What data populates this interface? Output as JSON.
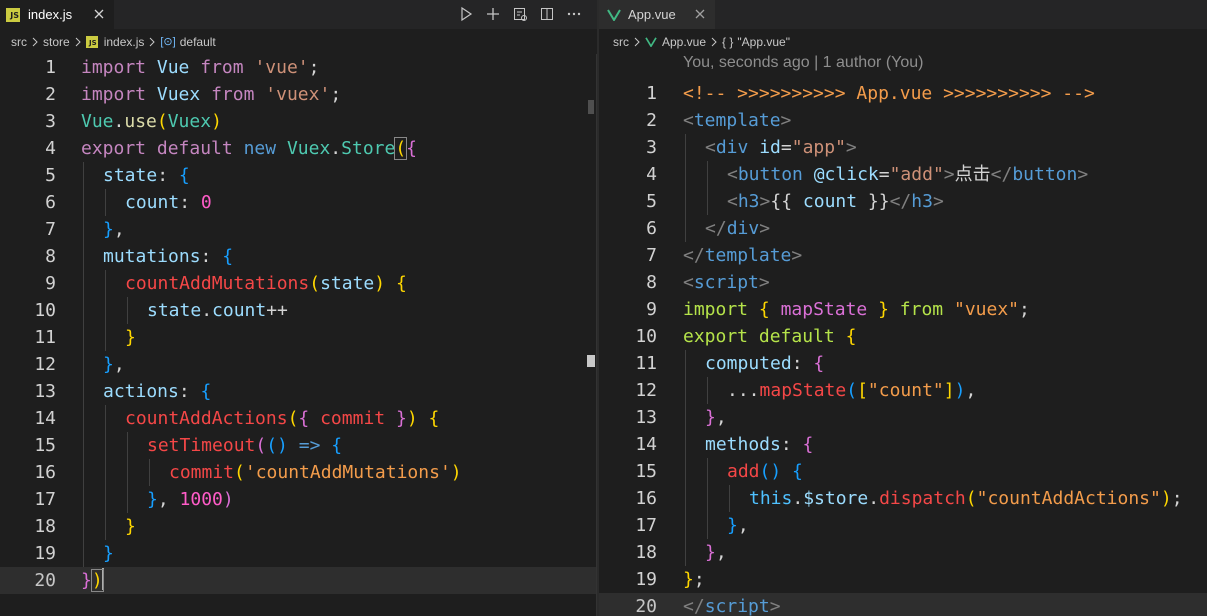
{
  "left_editor": {
    "tab": {
      "file_name": "index.js",
      "icon": "js-file-icon",
      "close": "close-icon"
    },
    "actions": [
      "run-icon",
      "split-add-icon",
      "open-changes-icon",
      "split-editor-icon",
      "more-actions-icon"
    ],
    "breadcrumb": {
      "folder1": "src",
      "folder2": "store",
      "file": "index.js",
      "symbol": "default"
    },
    "active_line": 20,
    "lines": [
      {
        "n": "1"
      },
      {
        "n": "2"
      },
      {
        "n": "3"
      },
      {
        "n": "4"
      },
      {
        "n": "5"
      },
      {
        "n": "6"
      },
      {
        "n": "7"
      },
      {
        "n": "8"
      },
      {
        "n": "9"
      },
      {
        "n": "10"
      },
      {
        "n": "11"
      },
      {
        "n": "12"
      },
      {
        "n": "13"
      },
      {
        "n": "14"
      },
      {
        "n": "15"
      },
      {
        "n": "16"
      },
      {
        "n": "17"
      },
      {
        "n": "18"
      },
      {
        "n": "19"
      },
      {
        "n": "20"
      }
    ],
    "tokens": {
      "l1": [
        "import",
        " ",
        "Vue",
        " ",
        "from",
        " ",
        "'vue'",
        ";"
      ],
      "l2": [
        "import",
        " ",
        "Vuex",
        " ",
        "from",
        " ",
        "'vuex'",
        ";"
      ],
      "l3": [
        "Vue",
        ".",
        "use",
        "(",
        "Vuex",
        ")"
      ],
      "l4": [
        "export",
        " ",
        "default",
        " ",
        "new",
        " ",
        "Vuex",
        ".",
        "Store",
        "(",
        "{"
      ],
      "l5": [
        "state",
        ": ",
        "{"
      ],
      "l6": [
        "count",
        ": ",
        "0"
      ],
      "l7": [
        "}",
        ","
      ],
      "l8": [
        "mutations",
        ": ",
        "{"
      ],
      "l9": [
        "countAddMutations",
        "(",
        "state",
        ") ",
        "{"
      ],
      "l10": [
        "state",
        ".",
        "count",
        "++"
      ],
      "l11": [
        "}"
      ],
      "l12": [
        "}",
        ","
      ],
      "l13": [
        "actions",
        ": ",
        "{"
      ],
      "l14": [
        "countAddActions",
        "(",
        "{ ",
        "commit",
        " }",
        ") ",
        "{"
      ],
      "l15": [
        "setTimeout",
        "(",
        "()",
        " => ",
        "{"
      ],
      "l16": [
        "commit",
        "(",
        "'countAddMutations'",
        ")"
      ],
      "l17": [
        "}",
        ", ",
        "1000",
        ")"
      ],
      "l18": [
        "}"
      ],
      "l19": [
        "}"
      ],
      "l20": [
        "}",
        ")"
      ]
    }
  },
  "right_editor": {
    "tab": {
      "file_name": "App.vue",
      "icon": "vue-file-icon",
      "close": "close-icon"
    },
    "breadcrumb": {
      "folder1": "src",
      "file": "App.vue",
      "symbol_icon": "{ }",
      "symbol": "\"App.vue\""
    },
    "codelens": "You, seconds ago | 1 author (You)",
    "active_line": 20,
    "lines": [
      {
        "n": "1"
      },
      {
        "n": "2"
      },
      {
        "n": "3"
      },
      {
        "n": "4"
      },
      {
        "n": "5"
      },
      {
        "n": "6"
      },
      {
        "n": "7"
      },
      {
        "n": "8"
      },
      {
        "n": "9"
      },
      {
        "n": "10"
      },
      {
        "n": "11"
      },
      {
        "n": "12"
      },
      {
        "n": "13"
      },
      {
        "n": "14"
      },
      {
        "n": "15"
      },
      {
        "n": "16"
      },
      {
        "n": "17"
      },
      {
        "n": "18"
      },
      {
        "n": "19"
      },
      {
        "n": "20"
      }
    ],
    "tokens": {
      "r1": "<!-- >>>>>>>>>> App.vue >>>>>>>>>> -->",
      "r2": [
        "<",
        "template",
        ">"
      ],
      "r3": [
        "<",
        "div",
        " ",
        "id",
        "=",
        "\"app\"",
        ">"
      ],
      "r4": [
        "<",
        "button",
        " ",
        "@click",
        "=",
        "\"add\"",
        ">",
        "点击",
        "</",
        "button",
        ">"
      ],
      "r5": [
        "<",
        "h3",
        ">",
        "{{ ",
        "count",
        " }}",
        "</",
        "h3",
        ">"
      ],
      "r6": [
        "</",
        "div",
        ">"
      ],
      "r7": [
        "</",
        "template",
        ">"
      ],
      "r8": [
        "<",
        "script",
        ">"
      ],
      "r9": [
        "import",
        " ",
        "{",
        " ",
        "mapState",
        " ",
        "}",
        " ",
        "from",
        " ",
        "\"vuex\"",
        ";"
      ],
      "r10": [
        "export",
        " ",
        "default",
        " ",
        "{"
      ],
      "r11": [
        "computed",
        ": ",
        "{"
      ],
      "r12": [
        "...",
        "mapState",
        "(",
        "[",
        "\"count\"",
        "]",
        ")",
        ","
      ],
      "r13": [
        "}",
        ","
      ],
      "r14": [
        "methods",
        ": ",
        "{"
      ],
      "r15": [
        "add",
        "()",
        " ",
        "{"
      ],
      "r16": [
        "this",
        ".",
        "$store",
        ".",
        "dispatch",
        "(",
        "\"countAddActions\"",
        ")",
        ";"
      ],
      "r17": [
        "}",
        ","
      ],
      "r18": [
        "}",
        ","
      ],
      "r19": [
        "}",
        ";"
      ],
      "r20": [
        "</",
        "script",
        ">"
      ]
    }
  },
  "colors": {
    "background": "#1e1e1e",
    "keyword": "#c586c0",
    "string": "#ce9178",
    "variable": "#9cdcfe",
    "function": "#dcdcaa",
    "class": "#4ec9b0",
    "bracket_gold": "#ffd700",
    "bracket_purple": "#da70d6",
    "bracket_blue": "#179fff"
  }
}
